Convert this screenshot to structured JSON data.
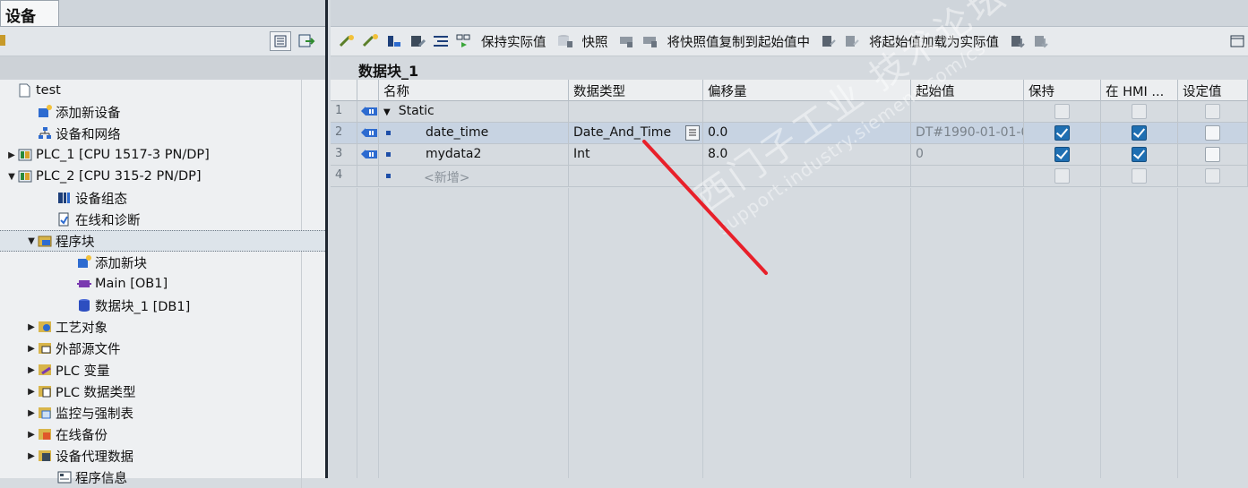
{
  "left_panel": {
    "tab": "设备",
    "tree": [
      {
        "label": "test",
        "indent": 0,
        "arrow": "",
        "icon": "project-file-icon"
      },
      {
        "label": "添加新设备",
        "indent": 1,
        "arrow": "",
        "icon": "add-device-icon"
      },
      {
        "label": "设备和网络",
        "indent": 1,
        "arrow": "",
        "icon": "network-icon"
      },
      {
        "label": "PLC_1 [CPU 1517-3 PN/DP]",
        "indent": 0,
        "arrow": "▶",
        "icon": "plc-icon"
      },
      {
        "label": "PLC_2 [CPU 315-2 PN/DP]",
        "indent": 0,
        "arrow": "▼",
        "icon": "plc-icon"
      },
      {
        "label": "设备组态",
        "indent": 2,
        "arrow": "",
        "icon": "device-config-icon"
      },
      {
        "label": "在线和诊断",
        "indent": 2,
        "arrow": "",
        "icon": "online-diagnostics-icon"
      },
      {
        "label": "程序块",
        "indent": 1,
        "arrow": "▼",
        "icon": "program-blocks-icon",
        "selected": true
      },
      {
        "label": "添加新块",
        "indent": 3,
        "arrow": "",
        "icon": "add-block-icon"
      },
      {
        "label": "Main [OB1]",
        "indent": 3,
        "arrow": "",
        "icon": "ob-block-icon"
      },
      {
        "label": "数据块_1 [DB1]",
        "indent": 3,
        "arrow": "",
        "icon": "db-block-icon"
      },
      {
        "label": "工艺对象",
        "indent": 1,
        "arrow": "▶",
        "icon": "technology-objects-icon"
      },
      {
        "label": "外部源文件",
        "indent": 1,
        "arrow": "▶",
        "icon": "external-source-icon"
      },
      {
        "label": "PLC 变量",
        "indent": 1,
        "arrow": "▶",
        "icon": "plc-tags-icon"
      },
      {
        "label": "PLC 数据类型",
        "indent": 1,
        "arrow": "▶",
        "icon": "plc-datatypes-icon"
      },
      {
        "label": "监控与强制表",
        "indent": 1,
        "arrow": "▶",
        "icon": "watch-force-table-icon"
      },
      {
        "label": "在线备份",
        "indent": 1,
        "arrow": "▶",
        "icon": "online-backup-icon"
      },
      {
        "label": "设备代理数据",
        "indent": 1,
        "arrow": "▶",
        "icon": "device-proxy-icon"
      },
      {
        "label": "程序信息",
        "indent": 2,
        "arrow": "",
        "icon": "program-info-icon"
      }
    ]
  },
  "toolbar": {
    "keep_actual": "保持实际值",
    "snapshot": "快照",
    "copy_snapshot": "将快照值复制到起始值中",
    "load_start": "将起始值加载为实际值"
  },
  "block_title": "数据块_1",
  "columns": [
    "名称",
    "数据类型",
    "偏移量",
    "起始值",
    "保持",
    "在 HMI ...",
    "设定值"
  ],
  "rows": [
    {
      "num": "1",
      "name": "Static",
      "type": "",
      "offset": "",
      "start": "",
      "retain": false,
      "hmi": false,
      "setpoint": false,
      "kind": "group"
    },
    {
      "num": "2",
      "name": "date_time",
      "type": "Date_And_Time",
      "offset": "0.0",
      "start": "DT#1990-01-01-0",
      "retain": true,
      "hmi": true,
      "setpoint": false,
      "kind": "var",
      "selected": true
    },
    {
      "num": "3",
      "name": "mydata2",
      "type": "Int",
      "offset": "8.0",
      "start": "0",
      "retain": true,
      "hmi": true,
      "setpoint": false,
      "kind": "var"
    },
    {
      "num": "4",
      "name": "<新增>",
      "type": "",
      "offset": "",
      "start": "",
      "retain": false,
      "hmi": false,
      "setpoint": false,
      "kind": "new"
    }
  ],
  "watermark": {
    "line1": "西门子工业 技术论坛",
    "line2": "support.industry.siemens.com/cs"
  },
  "colors": {
    "accent": "#1f6fb2",
    "annotation_line": "#e8202a"
  }
}
